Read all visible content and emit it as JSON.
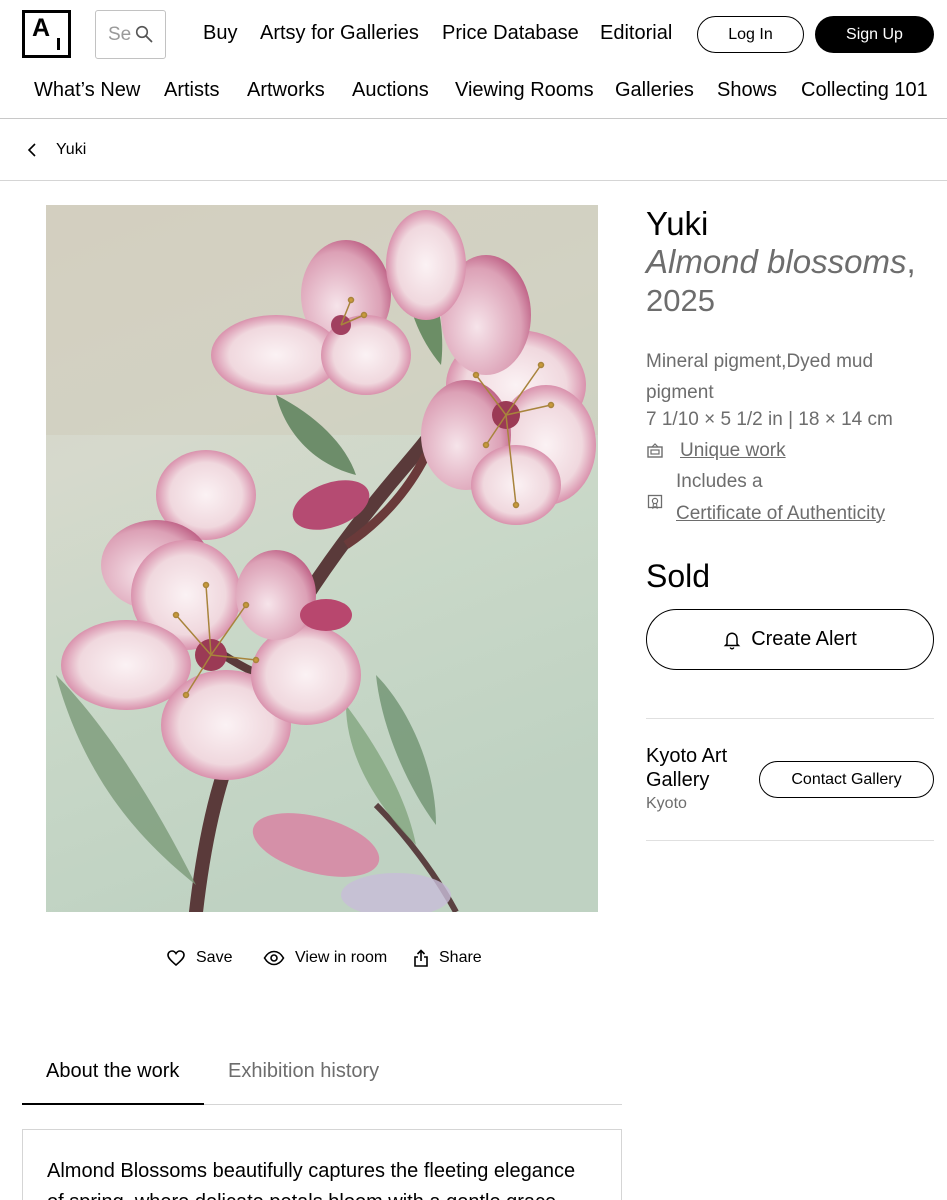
{
  "header": {
    "logo_text": "A",
    "search_placeholder": "Search",
    "nav": [
      "Buy",
      "Artsy for Galleries",
      "Price Database",
      "Editorial"
    ],
    "login_label": "Log In",
    "signup_label": "Sign Up"
  },
  "subnav": [
    "What’s New",
    "Artists",
    "Artworks",
    "Auctions",
    "Viewing Rooms",
    "Galleries",
    "Shows",
    "Collecting 101"
  ],
  "breadcrumb": {
    "label": "Yuki"
  },
  "artwork": {
    "artist": "Yuki",
    "title": "Almond blossoms",
    "title_suffix": ",",
    "year": "2025",
    "medium": "Mineral pigment,Dyed mud pigment",
    "dimensions": "7 1/10 × 5 1/2 in | 18 × 14 cm",
    "rarity_label": "Unique work",
    "coa_prefix": "Includes a",
    "coa_link": "Certificate of Authenticity",
    "status": "Sold",
    "create_alert_label": "Create Alert",
    "icons": [
      "frame-icon",
      "certificate-icon",
      "bell-icon"
    ]
  },
  "actions": {
    "save_label": "Save",
    "view_in_room_label": "View in room",
    "share_label": "Share",
    "icons": [
      "heart-icon",
      "eye-icon",
      "share-icon"
    ]
  },
  "gallery": {
    "name": "Kyoto Art Gallery",
    "location": "Kyoto",
    "contact_label": "Contact Gallery"
  },
  "tabs": [
    {
      "label": "About the work",
      "active": true
    },
    {
      "label": "Exhibition history",
      "active": false
    }
  ],
  "about": {
    "text": "Almond Blossoms beautifully captures the fleeting elegance of spring, where delicate petals bloom with a gentle grace. The"
  },
  "colors": {
    "text_primary": "#000000",
    "text_secondary": "#6d6d6d",
    "divider": "#d5d5d5",
    "button_dark": "#000000"
  }
}
